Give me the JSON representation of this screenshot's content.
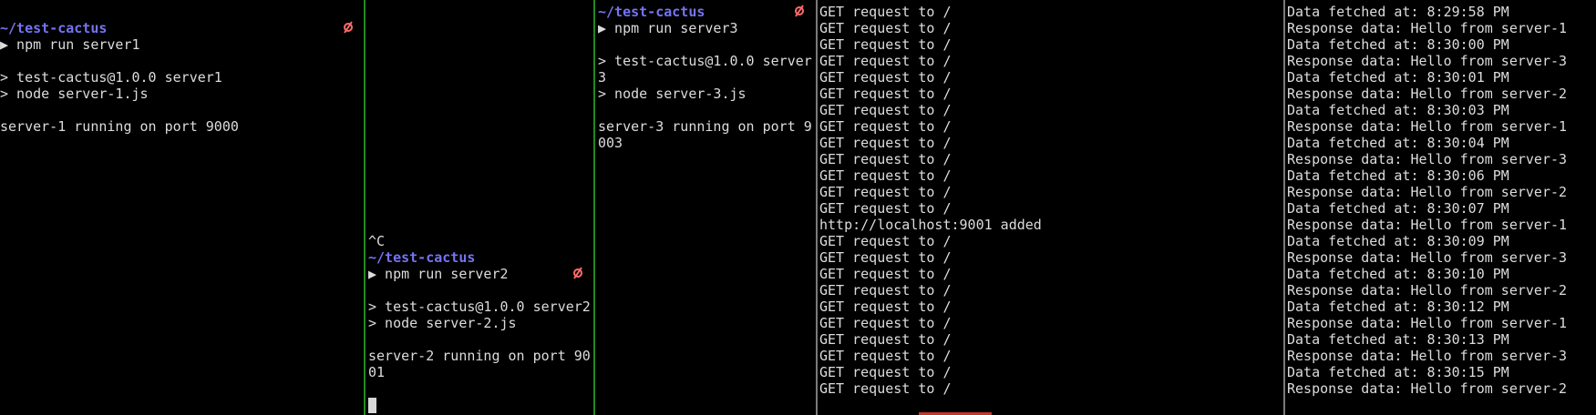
{
  "colors": {
    "prompt": "#7474f4",
    "git_icon": "#ff6b6b",
    "text": "#dcdcdc",
    "active_divider": "#1f8a1f",
    "inactive_divider": "#7a7a7a"
  },
  "panes": [
    {
      "name": "server1",
      "lines": [
        {
          "row": 1,
          "text": "~/test-cactus",
          "kind": "prompt"
        },
        {
          "row": 2,
          "text": "▶ npm run server1"
        },
        {
          "row": 4,
          "text": "> test-cactus@1.0.0 server1"
        },
        {
          "row": 5,
          "text": "> node server-1.js"
        },
        {
          "row": 7,
          "text": "server-1 running on port 9000"
        }
      ]
    },
    {
      "name": "server2",
      "lines": [
        {
          "row": 14,
          "text": "^C"
        },
        {
          "row": 15,
          "text": "~/test-cactus",
          "kind": "prompt"
        },
        {
          "row": 16,
          "text": "▶ npm run server2"
        },
        {
          "row": 18,
          "text": "> test-cactus@1.0.0 server2"
        },
        {
          "row": 19,
          "text": "> node server-2.js"
        },
        {
          "row": 21,
          "text": "server-2 running on port 90"
        },
        {
          "row": 22,
          "text": "01"
        }
      ],
      "cursor_row": 23
    },
    {
      "name": "server3",
      "lines": [
        {
          "row": 0,
          "text": "~/test-cactus",
          "kind": "prompt"
        },
        {
          "row": 1,
          "text": "▶ npm run server3"
        },
        {
          "row": 3,
          "text": "> test-cactus@1.0.0 server"
        },
        {
          "row": 4,
          "text": "3"
        },
        {
          "row": 5,
          "text": "> node server-3.js"
        },
        {
          "row": 7,
          "text": "server-3 running on port 9"
        },
        {
          "row": 8,
          "text": "003"
        }
      ]
    },
    {
      "name": "load-balancer",
      "lines": [
        {
          "row": 0,
          "text": "GET request to /"
        },
        {
          "row": 1,
          "text": "GET request to /"
        },
        {
          "row": 2,
          "text": "GET request to /"
        },
        {
          "row": 3,
          "text": "GET request to /"
        },
        {
          "row": 4,
          "text": "GET request to /"
        },
        {
          "row": 5,
          "text": "GET request to /"
        },
        {
          "row": 6,
          "text": "GET request to /"
        },
        {
          "row": 7,
          "text": "GET request to /"
        },
        {
          "row": 8,
          "text": "GET request to /"
        },
        {
          "row": 9,
          "text": "GET request to /"
        },
        {
          "row": 10,
          "text": "GET request to /"
        },
        {
          "row": 11,
          "text": "GET request to /"
        },
        {
          "row": 12,
          "text": "GET request to /"
        },
        {
          "row": 13,
          "text": "http://localhost:9001 added"
        },
        {
          "row": 14,
          "text": "GET request to /"
        },
        {
          "row": 15,
          "text": "GET request to /"
        },
        {
          "row": 16,
          "text": "GET request to /"
        },
        {
          "row": 17,
          "text": "GET request to /"
        },
        {
          "row": 18,
          "text": "GET request to /"
        },
        {
          "row": 19,
          "text": "GET request to /"
        },
        {
          "row": 20,
          "text": "GET request to /"
        },
        {
          "row": 21,
          "text": "GET request to /"
        },
        {
          "row": 22,
          "text": "GET request to /"
        },
        {
          "row": 23,
          "text": "GET request to /"
        }
      ]
    },
    {
      "name": "client",
      "lines": [
        {
          "row": 0,
          "text": "Data fetched at: 8:29:58 PM"
        },
        {
          "row": 1,
          "text": "Response data: Hello from server-1"
        },
        {
          "row": 2,
          "text": "Data fetched at: 8:30:00 PM"
        },
        {
          "row": 3,
          "text": "Response data: Hello from server-3"
        },
        {
          "row": 4,
          "text": "Data fetched at: 8:30:01 PM"
        },
        {
          "row": 5,
          "text": "Response data: Hello from server-2"
        },
        {
          "row": 6,
          "text": "Data fetched at: 8:30:03 PM"
        },
        {
          "row": 7,
          "text": "Response data: Hello from server-1"
        },
        {
          "row": 8,
          "text": "Data fetched at: 8:30:04 PM"
        },
        {
          "row": 9,
          "text": "Response data: Hello from server-3"
        },
        {
          "row": 10,
          "text": "Data fetched at: 8:30:06 PM"
        },
        {
          "row": 11,
          "text": "Response data: Hello from server-2"
        },
        {
          "row": 12,
          "text": "Data fetched at: 8:30:07 PM"
        },
        {
          "row": 13,
          "text": "Response data: Hello from server-1"
        },
        {
          "row": 14,
          "text": "Data fetched at: 8:30:09 PM"
        },
        {
          "row": 15,
          "text": "Response data: Hello from server-3"
        },
        {
          "row": 16,
          "text": "Data fetched at: 8:30:10 PM"
        },
        {
          "row": 17,
          "text": "Response data: Hello from server-2"
        },
        {
          "row": 18,
          "text": "Data fetched at: 8:30:12 PM"
        },
        {
          "row": 19,
          "text": "Response data: Hello from server-1"
        },
        {
          "row": 20,
          "text": "Data fetched at: 8:30:13 PM"
        },
        {
          "row": 21,
          "text": "Response data: Hello from server-3"
        },
        {
          "row": 22,
          "text": "Data fetched at: 8:30:15 PM"
        },
        {
          "row": 23,
          "text": "Response data: Hello from server-2"
        }
      ]
    }
  ]
}
